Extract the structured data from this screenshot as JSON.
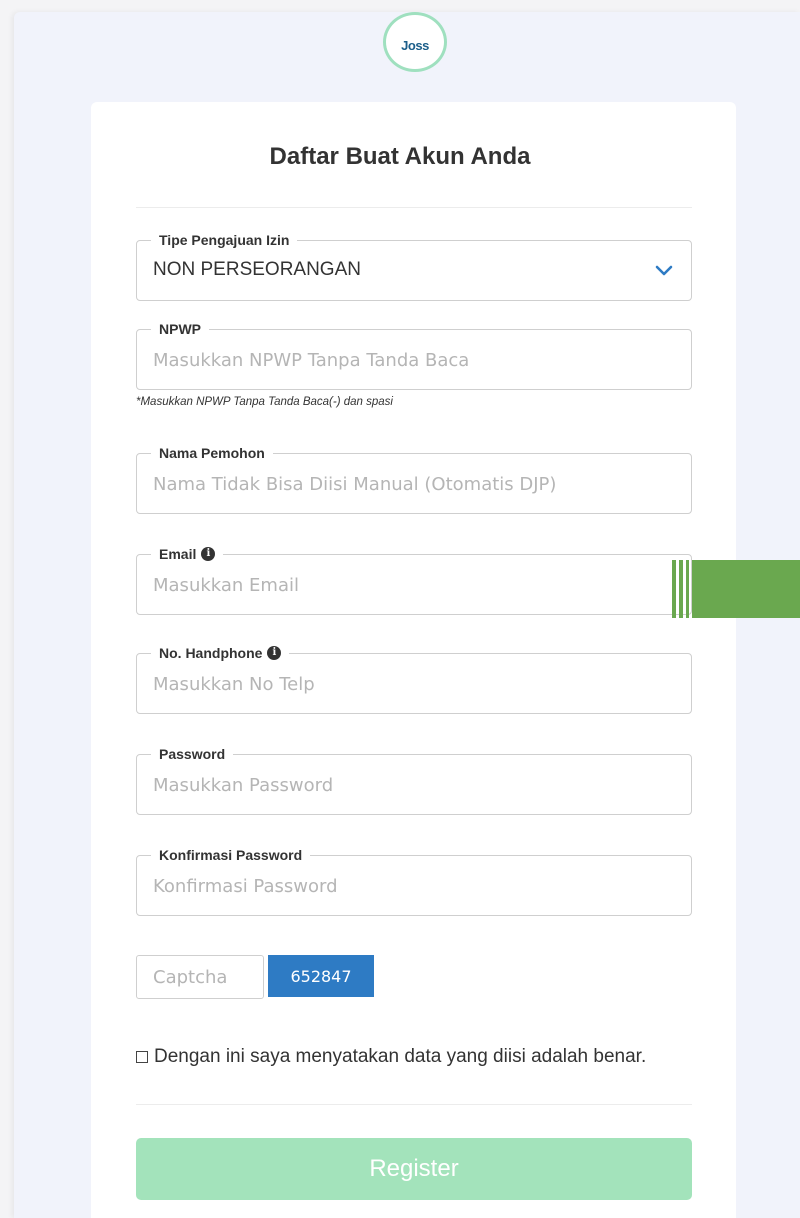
{
  "logo": {
    "text": "Joss"
  },
  "form": {
    "title": "Daftar Buat Akun Anda",
    "tipe": {
      "label": "Tipe Pengajuan Izin",
      "value": "NON PERSEORANGAN"
    },
    "npwp": {
      "label": "NPWP",
      "placeholder": "Masukkan NPWP Tanpa Tanda Baca",
      "hint": "*Masukkan NPWP Tanpa Tanda Baca(-) dan spasi"
    },
    "nama": {
      "label": "Nama Pemohon",
      "placeholder": "Nama Tidak Bisa Diisi Manual (Otomatis DJP)"
    },
    "email": {
      "label": "Email",
      "placeholder": "Masukkan Email"
    },
    "phone": {
      "label": "No. Handphone",
      "placeholder": "Masukkan No Telp"
    },
    "password": {
      "label": "Password",
      "placeholder": "Masukkan Password"
    },
    "confirm": {
      "label": "Konfirmasi Password",
      "placeholder": "Konfirmasi Password"
    },
    "captcha": {
      "placeholder": "Captcha",
      "code": "652847"
    },
    "agree_label": "Dengan ini saya menyatakan data yang diisi adalah benar.",
    "register_label": "Register"
  },
  "colors": {
    "accent": "#2e7bc4",
    "register_bg": "#a3e3bb",
    "green_tab": "#6aa84f"
  }
}
